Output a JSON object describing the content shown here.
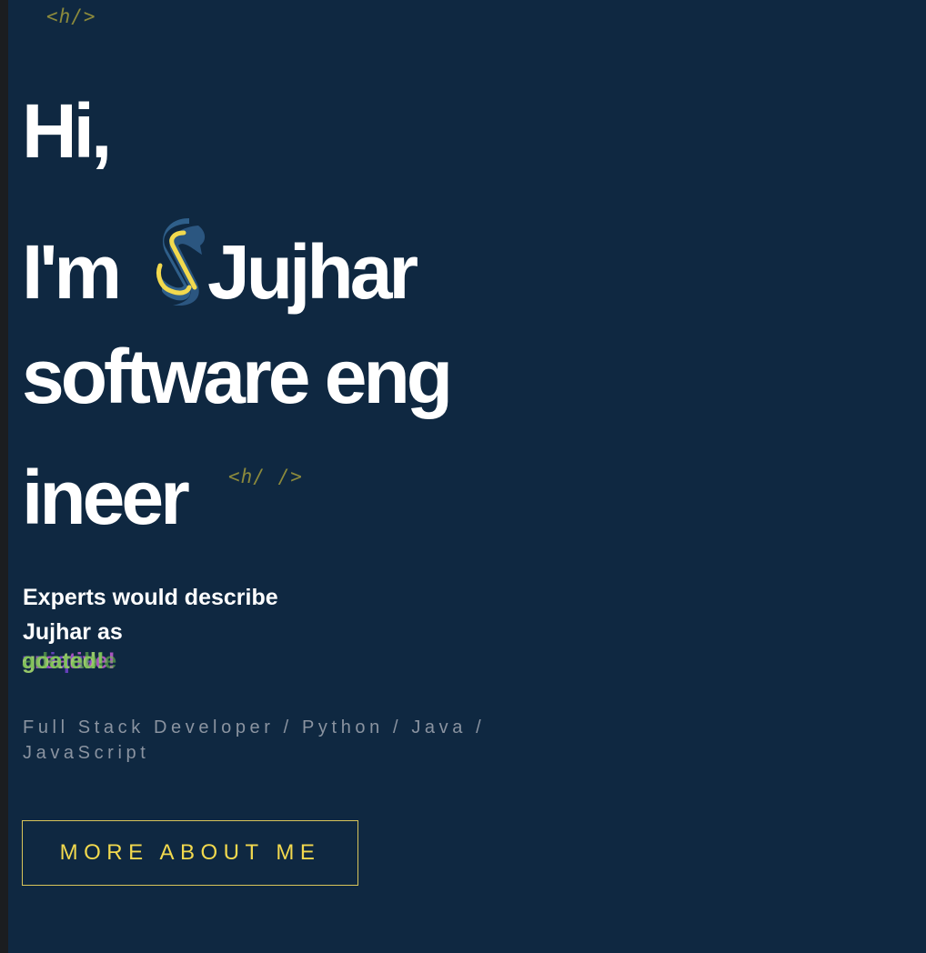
{
  "decor": {
    "tag_top": "<h/>",
    "tag_inline": "<h/ />"
  },
  "hero": {
    "line1": "Hi,",
    "line2_prefix": "I'm",
    "line2_name": "Jujhar",
    "line3": "software eng",
    "line4": "ineer",
    "logo_icon": "python-style-s-logo-icon"
  },
  "describe": {
    "line1": "Experts would describe",
    "line2": "Jujhar as"
  },
  "rotating_words": [
    "creative!",
    "unique!",
    "goated!",
    "adorable"
  ],
  "tagline": "Full Stack Developer / Python / Java / JavaScript",
  "cta": {
    "label": "MORE ABOUT ME"
  },
  "colors": {
    "background": "#0f2841",
    "accent_yellow": "#f2d94e",
    "tag_olive": "#8c8a3c",
    "text_white": "#ffffff",
    "tagline_gray": "#8a93a0"
  }
}
